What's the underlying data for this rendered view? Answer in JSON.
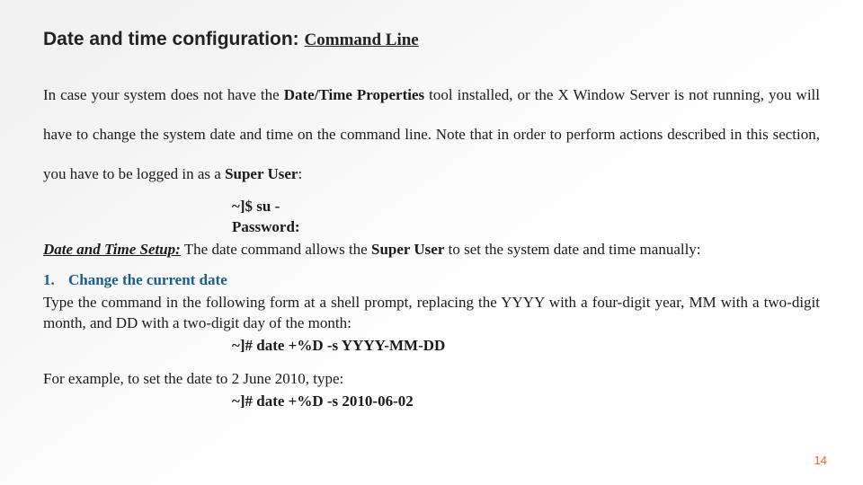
{
  "title": {
    "main": "Date and time configuration:",
    "sub": "Command Line"
  },
  "intro": {
    "pre": "In case your system does not have the ",
    "bold1": "Date/Time Properties",
    "mid": " tool installed, or the X Window Server is not running, you will have to change the system date and time on the command line. Note that in order to perform actions described in this section, you have to be logged in as a ",
    "bold2": "Super User",
    "post": ":"
  },
  "login_cmds": {
    "line1": "~]$ su -",
    "line2": "Password:"
  },
  "setup": {
    "label": "Date and Time Setup:",
    "pre": " The date command allows the ",
    "bold": "Super User",
    "post": " to set the system date and time manually:"
  },
  "step": {
    "num": "1.",
    "heading": "Change the current date",
    "body": "Type the command in the following form at a shell prompt, replacing the YYYY with a four-digit year, MM with a two-digit month, and DD with a two-digit day of the month:",
    "cmd": "~]# date +%D -s YYYY-MM-DD"
  },
  "example": {
    "text": "For example, to set the date to 2 June 2010, type:",
    "cmd": "~]# date +%D -s 2010-06-02"
  },
  "page_number": "14"
}
